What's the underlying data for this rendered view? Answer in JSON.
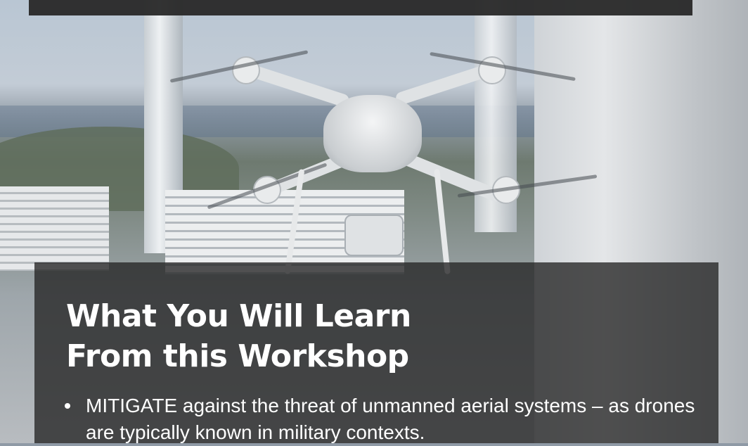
{
  "background": {
    "image": "drone-over-power-plant-photo",
    "overlay_color": "#242424"
  },
  "workshop": {
    "title_line1": "What You Will Learn",
    "title_line2": "From this Workshop",
    "items": [
      "MITIGATE against the threat of unmanned aerial systems – as drones are typically known in military contexts."
    ]
  }
}
